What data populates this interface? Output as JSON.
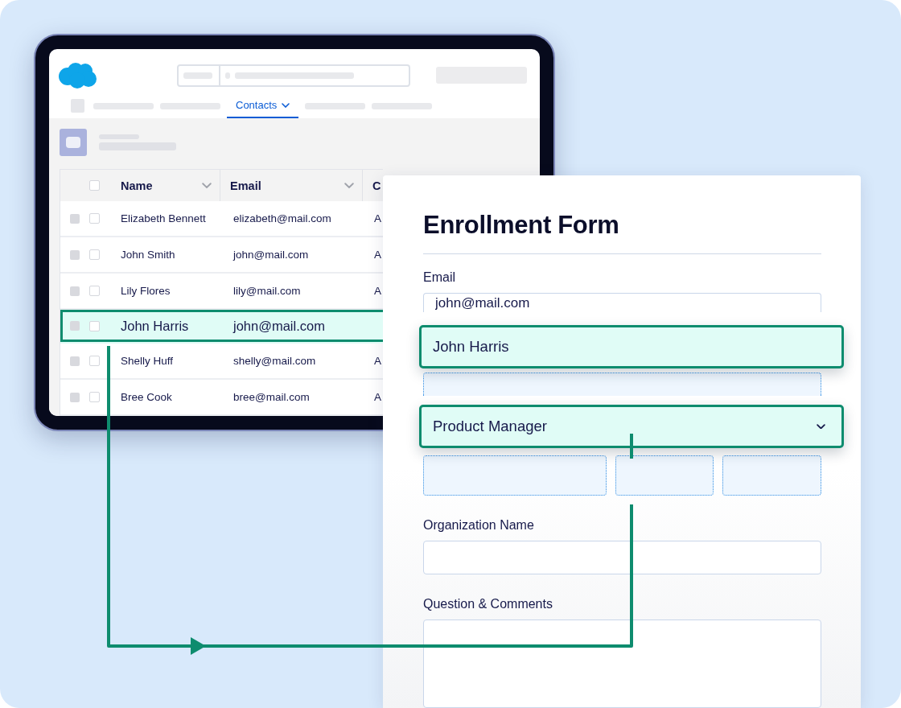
{
  "crm": {
    "tabs": [
      {
        "label": "Contacts",
        "selected": true
      }
    ],
    "table": {
      "all_checked": false,
      "columns": [
        "Name",
        "Email",
        "C"
      ],
      "rows": [
        {
          "name": "Elizabeth Bennett",
          "email": "elizabeth@mail.com",
          "column_3": "A",
          "checked": false,
          "selected": false
        },
        {
          "name": "John Smith",
          "email": "john@mail.com",
          "column_3": "A",
          "checked": false,
          "selected": false
        },
        {
          "name": "Lily Flores",
          "email": "lily@mail.com",
          "column_3": "A",
          "checked": false,
          "selected": false
        },
        {
          "name": "John Harris",
          "email": "john@mail.com",
          "checked": false,
          "selected": true
        },
        {
          "name": "Shelly Huff",
          "email": "shelly@mail.com",
          "column_3": "A",
          "checked": false,
          "selected": false
        },
        {
          "name": "Bree Cook",
          "email": "bree@mail.com",
          "column_3": "A",
          "checked": false,
          "selected": false
        }
      ]
    }
  },
  "enrollment_form": {
    "title": "Enrollment Form",
    "fields": [
      {
        "kind": "text",
        "label": "Email",
        "value": "john@mail.com"
      },
      {
        "kind": "drop_slot"
      },
      {
        "kind": "drop_slot_split"
      },
      {
        "kind": "text",
        "label": "Organization Name"
      },
      {
        "kind": "textarea",
        "label": "Question & Comments"
      }
    ]
  },
  "mapped_values": [
    {
      "kind": "text",
      "value": "John Harris"
    },
    {
      "kind": "select",
      "value": "Product Manager"
    }
  ]
}
